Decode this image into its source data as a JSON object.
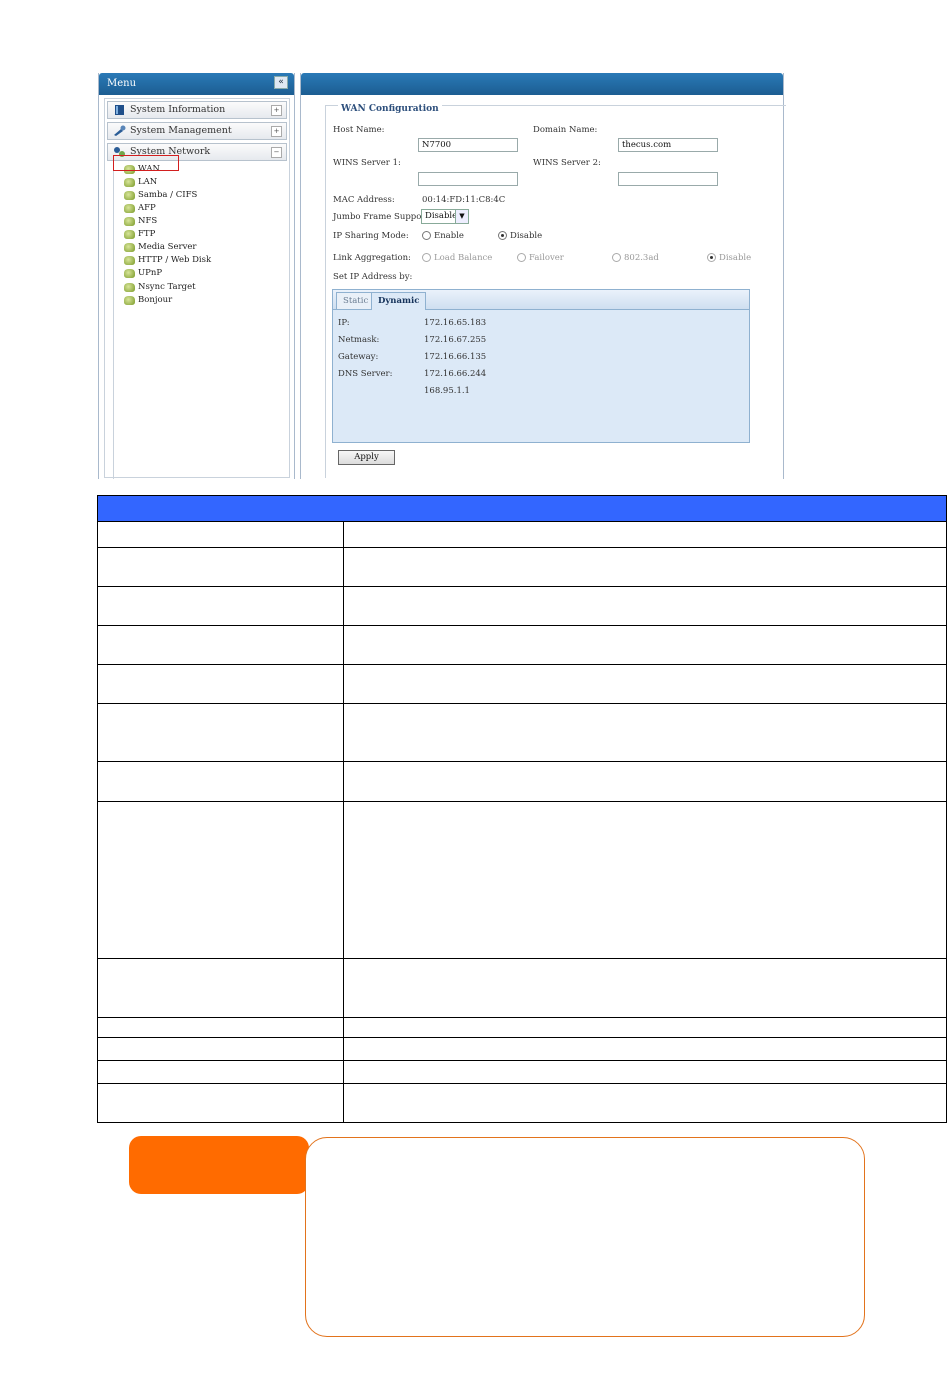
{
  "menu": {
    "title": "Menu",
    "collapse_glyph": "«",
    "categories": [
      {
        "label": "System Information",
        "icon": "book-icon",
        "expand": "+"
      },
      {
        "label": "System Management",
        "icon": "wrench-icon",
        "expand": "+"
      },
      {
        "label": "System Network",
        "icon": "network-icon",
        "expand": "−"
      }
    ],
    "network_items": [
      "WAN",
      "LAN",
      "Samba / CIFS",
      "AFP",
      "NFS",
      "FTP",
      "Media Server",
      "HTTP / Web Disk",
      "UPnP",
      "Nsync Target",
      "Bonjour"
    ],
    "selected_item": "WAN"
  },
  "wan": {
    "legend": "WAN Configuration",
    "host_name_label": "Host Name:",
    "host_name_value": "N7700",
    "domain_name_label": "Domain Name:",
    "domain_name_value": "thecus.com",
    "wins1_label": "WINS Server 1:",
    "wins1_value": "",
    "wins2_label": "WINS Server 2:",
    "wins2_value": "",
    "mac_label": "MAC Address:",
    "mac_value": "00:14:FD:11:C8:4C",
    "jumbo_label": "Jumbo Frame Support:",
    "jumbo_value": "Disable",
    "ip_sharing_label": "IP Sharing Mode:",
    "ip_sharing_options": [
      "Enable",
      "Disable"
    ],
    "ip_sharing_selected": "Disable",
    "link_agg_label": "Link Aggregation:",
    "link_agg_options": [
      "Load Balance",
      "Failover",
      "802.3ad",
      "Disable"
    ],
    "link_agg_selected": "Disable",
    "set_ip_label": "Set IP Address by:",
    "tabs": [
      "Static",
      "Dynamic"
    ],
    "active_tab": "Dynamic",
    "ip_label": "IP:",
    "ip_value": "172.16.65.183",
    "netmask_label": "Netmask:",
    "netmask_value": "172.16.67.255",
    "gateway_label": "Gateway:",
    "gateway_value": "172.16.66.135",
    "dns_label": "DNS Server:",
    "dns_values": [
      "172.16.66.244",
      "168.95.1.1"
    ],
    "apply_label": "Apply"
  },
  "table": {
    "header_color": "#3366ff",
    "row_count": 14
  },
  "note": {
    "tab_color": "#ff6b00",
    "border_color": "#e2731c"
  }
}
